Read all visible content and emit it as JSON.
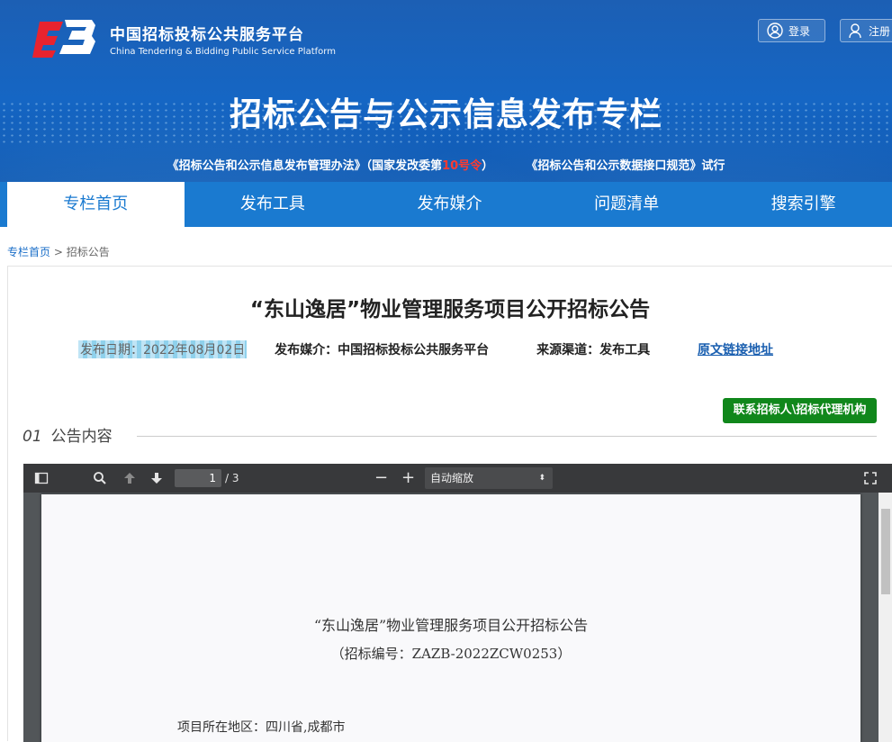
{
  "header": {
    "site_name_cn": "中国招标投标公共服务平台",
    "site_name_en": "China Tendering & Bidding Public Service Platform",
    "login_label": "登录",
    "register_label": "注册",
    "banner_title": "招标公告与公示信息发布专栏",
    "notice_part1": "《招标公告和公示信息发布管理办法》（国家发改委第",
    "notice_highlight": "10号令",
    "notice_part2": "）",
    "notice_part3": "《招标公告和公示数据接口规范》试行"
  },
  "nav": {
    "items": [
      {
        "label": "专栏首页"
      },
      {
        "label": "发布工具"
      },
      {
        "label": "发布媒介"
      },
      {
        "label": "问题清单"
      },
      {
        "label": "搜索引擎"
      }
    ]
  },
  "breadcrumb": {
    "home": "专栏首页",
    "separator": ">",
    "current": "招标公告"
  },
  "article": {
    "title": "“东山逸居”物业管理服务项目公开招标公告",
    "publish_date": "发布日期：2022年08月02日",
    "media": "发布媒介：中国招标投标公共服务平台",
    "source": "来源渠道：发布工具",
    "original_link": "原文链接地址",
    "contact_button": "联系招标人\\招标代理机构",
    "section_number": "01",
    "section_title": "公告内容"
  },
  "viewer": {
    "current_page": "1",
    "total_pages": "/ 3",
    "zoom": "自动缩放",
    "doc_title": "“东山逸居”物业管理服务项目公开招标公告",
    "doc_number": "（招标编号：ZAZB-2022ZCW0253）",
    "doc_location": "项目所在地区：四川省,成都市"
  }
}
